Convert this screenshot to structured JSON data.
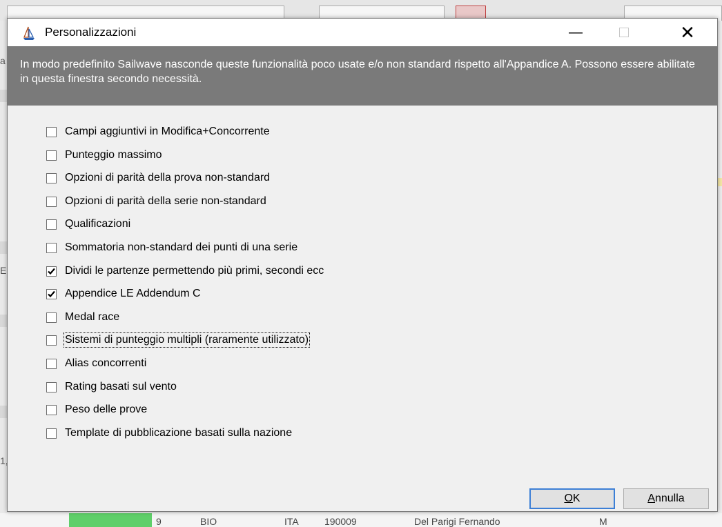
{
  "window": {
    "title": "Personalizzazioni",
    "minimize_glyph": "—",
    "close_glyph": "✕"
  },
  "banner": {
    "text": "In modo predefinito Sailwave nasconde queste funzionalità poco usate e/o non standard rispetto all'Appandice A. Possono essere abilitate in questa finestra secondo necessità."
  },
  "options": [
    {
      "label": "Campi aggiuntivi in Modifica+Concorrente",
      "checked": false
    },
    {
      "label": "Punteggio massimo",
      "checked": false
    },
    {
      "label": "Opzioni di parità della prova non-standard",
      "checked": false
    },
    {
      "label": "Opzioni di parità della serie non-standard",
      "checked": false
    },
    {
      "label": "Qualificazioni",
      "checked": false
    },
    {
      "label": "Sommatoria non-standard dei punti di una serie",
      "checked": false
    },
    {
      "label": "Dividi le partenze permettendo più primi, secondi ecc",
      "checked": true
    },
    {
      "label": "Appendice LE Addendum C",
      "checked": true
    },
    {
      "label": "Medal race",
      "checked": false
    },
    {
      "label": "Sistemi di punteggio multipli (raramente utilizzato)",
      "checked": false,
      "focused": true
    },
    {
      "label": "Alias concorrenti",
      "checked": false
    },
    {
      "label": "Rating basati sul vento",
      "checked": false
    },
    {
      "label": "Peso delle prove",
      "checked": false
    },
    {
      "label": "Template di pubblicazione basati sulla nazione",
      "checked": false
    }
  ],
  "buttons": {
    "ok_mnemonic": "O",
    "ok_rest": "K",
    "cancel_mnemonic": "A",
    "cancel_rest": "nnulla"
  },
  "background": {
    "left_chars": [
      "a",
      "E",
      "1,"
    ],
    "bottom_cells": [
      "9",
      "BIO",
      "ITA",
      "190009",
      "Del Parigi Fernando",
      "M"
    ]
  },
  "colors": {
    "banner": "#7a7a7a",
    "ok_border": "#3c7fd6",
    "bg_green": "#5fcf6a"
  },
  "icons": {
    "app": "sailboat-icon",
    "checkmark": "check-icon"
  }
}
